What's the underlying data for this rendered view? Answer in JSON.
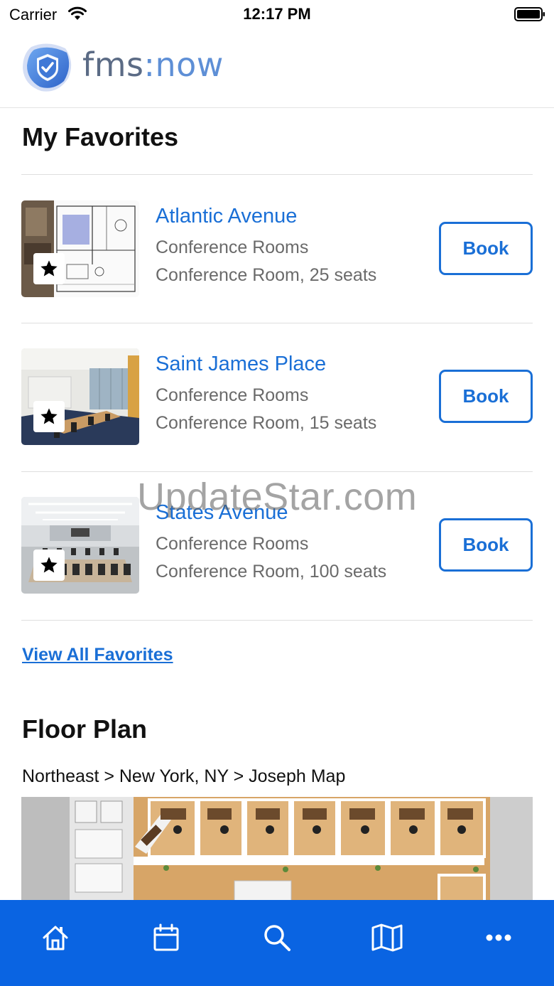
{
  "status_bar": {
    "carrier": "Carrier",
    "time": "12:17 PM"
  },
  "header": {
    "logo_text_a": "fms",
    "logo_text_b": ":now"
  },
  "favorites": {
    "title": "My Favorites",
    "items": [
      {
        "name": "Atlantic Avenue",
        "category": "Conference Rooms",
        "description": "Conference Room, 25 seats",
        "book_label": "Book",
        "thumbnail": "floorplan-photo"
      },
      {
        "name": "Saint James Place",
        "category": "Conference Rooms",
        "description": "Conference Room, 15 seats",
        "book_label": "Book",
        "thumbnail": "conference-room-photo"
      },
      {
        "name": "States Avenue",
        "category": "Conference Rooms",
        "description": "Conference Room, 100 seats",
        "book_label": "Book",
        "thumbnail": "large-conference-room-photo"
      }
    ],
    "view_all_label": "View All Favorites"
  },
  "floor_plan": {
    "title": "Floor Plan",
    "breadcrumb": "Northeast > New York, NY > Joseph Map"
  },
  "watermark": "UpdateStar.com",
  "tab_bar": {
    "tabs": [
      {
        "icon": "home-icon"
      },
      {
        "icon": "calendar-icon"
      },
      {
        "icon": "search-icon"
      },
      {
        "icon": "map-icon"
      },
      {
        "icon": "more-icon"
      }
    ]
  },
  "colors": {
    "accent": "#1a6fd6",
    "tab_bar": "#0a64e2",
    "logo_text": "#5b6b85"
  }
}
